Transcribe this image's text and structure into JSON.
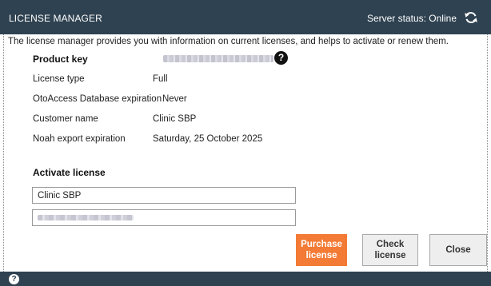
{
  "window": {
    "title": "LICENSE MANAGER",
    "server_status": "Server status: Online",
    "refresh_icon": "refresh-icon"
  },
  "intro": "The license manager provides you with information on current licenses, and helps to activate or renew them.",
  "info": {
    "product_key_label": "Product key",
    "license_type_label": "License type",
    "license_type_value": "Full",
    "otoaccess_label": "OtoAccess Database expiration",
    "otoaccess_value": "Never",
    "customer_label": "Customer name",
    "customer_value": "Clinic SBP",
    "noah_label": "Noah export expiration",
    "noah_value": "Saturday, 25 October 2025",
    "help_icon": "question-icon"
  },
  "activate": {
    "title": "Activate license",
    "customer_field_value": "Clinic SBP"
  },
  "buttons": {
    "purchase": "Purchase license",
    "check": "Check license",
    "close": "Close"
  },
  "colors": {
    "titlebar": "#2f4251",
    "accent": "#f37b35"
  }
}
